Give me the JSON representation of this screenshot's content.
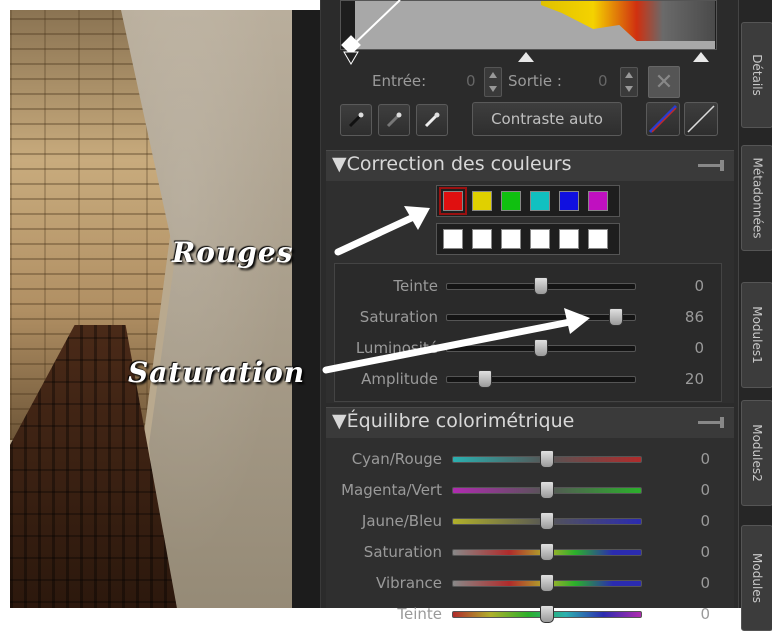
{
  "curves": {
    "input_label": "Entrée:",
    "input_value": "0",
    "output_label": "Sortie :",
    "output_value": "0",
    "auto_contrast_label": "Contraste auto"
  },
  "color_correction": {
    "title": "Correction des couleurs",
    "swatches_top": [
      "#e01010",
      "#e0d000",
      "#10c010",
      "#10c0c0",
      "#1010e0",
      "#c010c0"
    ],
    "swatches_bottom": [
      "#ffffff",
      "#ffffff",
      "#ffffff",
      "#ffffff",
      "#ffffff",
      "#ffffff"
    ],
    "sliders": [
      {
        "label": "Teinte",
        "value": "0"
      },
      {
        "label": "Saturation",
        "value": "86"
      },
      {
        "label": "Luminosité",
        "value": "0"
      },
      {
        "label": "Amplitude",
        "value": "20"
      }
    ]
  },
  "color_balance": {
    "title": "Équilibre colorimétrique",
    "sliders": [
      {
        "label": "Cyan/Rouge",
        "value": "0"
      },
      {
        "label": "Magenta/Vert",
        "value": "0"
      },
      {
        "label": "Jaune/Bleu",
        "value": "0"
      },
      {
        "label": "Saturation",
        "value": "0"
      },
      {
        "label": "Vibrance",
        "value": "0"
      },
      {
        "label": "Teinte",
        "value": "0"
      }
    ]
  },
  "side_tabs": [
    "Détails",
    "Métadonnées",
    "Modules1",
    "Modules2",
    "Modules"
  ],
  "annotations": {
    "rouges": "Rouges",
    "saturation": "Saturation"
  },
  "colors": {
    "panel_bg": "#2b2b2b",
    "accent_red": "#e01010"
  }
}
